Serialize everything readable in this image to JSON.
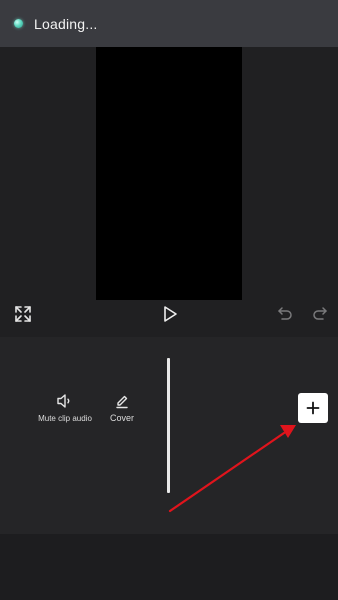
{
  "status": {
    "text": "Loading..."
  },
  "controls": {
    "fullscreen_icon": "fullscreen-icon",
    "play_icon": "play-icon",
    "undo_icon": "undo-icon",
    "redo_icon": "redo-icon"
  },
  "tools": [
    {
      "label": "Mute clip audio",
      "icon": "speaker-icon"
    },
    {
      "label": "Cover",
      "icon": "pencil-icon"
    }
  ],
  "add_clip": {
    "icon": "plus-icon"
  },
  "annotation": {
    "color": "#e0141c"
  }
}
